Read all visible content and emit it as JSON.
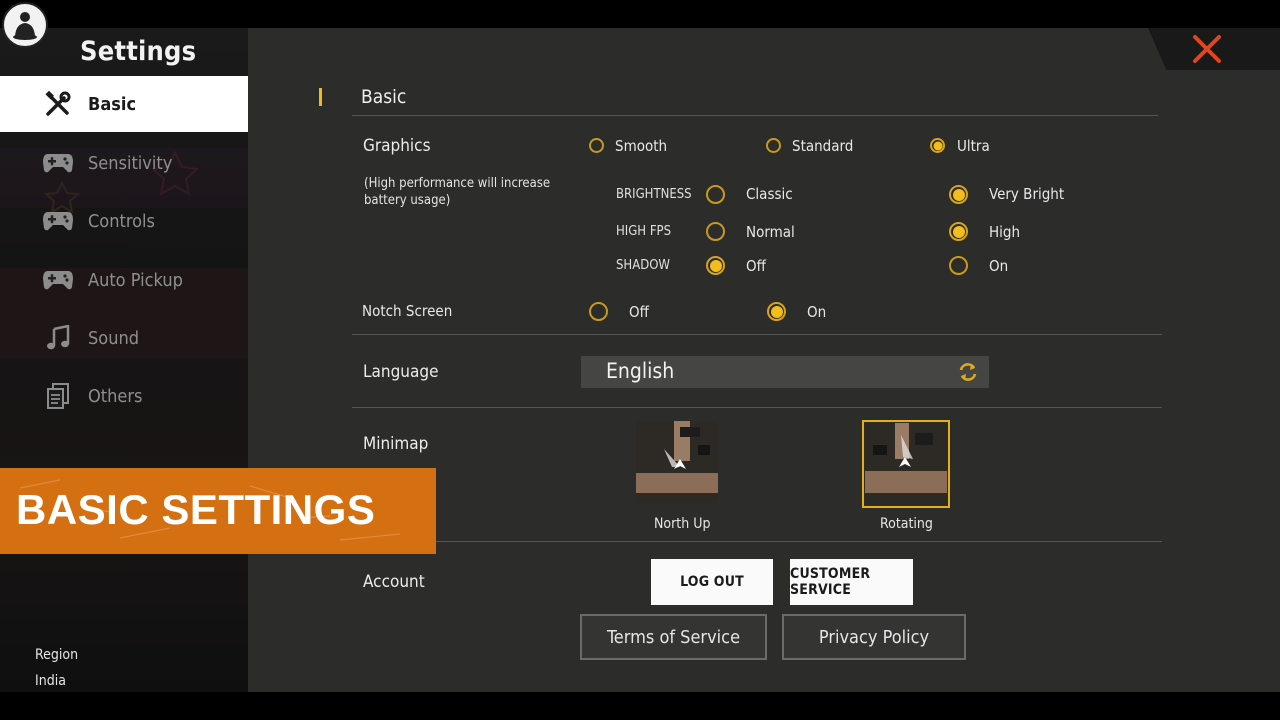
{
  "sidebar": {
    "title": "Settings",
    "items": [
      {
        "label": "Basic",
        "icon": "wrench-screwdriver-icon",
        "active": true
      },
      {
        "label": "Sensitivity",
        "icon": "gamepad-icon",
        "active": false
      },
      {
        "label": "Controls",
        "icon": "gamepad-icon",
        "active": false
      },
      {
        "label": "Auto Pickup",
        "icon": "gamepad-icon",
        "active": false
      },
      {
        "label": "Sound",
        "icon": "music-note-icon",
        "active": false
      },
      {
        "label": "Others",
        "icon": "document-icon",
        "active": false
      }
    ],
    "region_label": "Region",
    "region_value": "India"
  },
  "main": {
    "section_title": "Basic",
    "graphics": {
      "label": "Graphics",
      "note": "(High performance will increase battery usage)",
      "options": [
        {
          "label": "Smooth",
          "selected": false
        },
        {
          "label": "Standard",
          "selected": false
        },
        {
          "label": "Ultra",
          "selected": true
        }
      ],
      "brightness": {
        "label": "BRIGHTNESS",
        "opt1": "Classic",
        "opt2": "Very Bright",
        "selected": "Very Bright"
      },
      "high_fps": {
        "label": "HIGH FPS",
        "opt1": "Normal",
        "opt2": "High",
        "selected": "High"
      },
      "shadow": {
        "label": "SHADOW",
        "opt1": "Off",
        "opt2": "On",
        "selected": "Off"
      }
    },
    "notch_screen": {
      "label": "Notch Screen",
      "opt1": "Off",
      "opt2": "On",
      "selected": "On"
    },
    "language": {
      "label": "Language",
      "value": "English"
    },
    "minimap": {
      "label": "Minimap",
      "opt1": "North Up",
      "opt2": "Rotating",
      "selected": "Rotating"
    },
    "account": {
      "label": "Account",
      "logout": "LOG OUT",
      "customer_service": "CUSTOMER SERVICE",
      "terms": "Terms of Service",
      "privacy": "Privacy Policy"
    }
  },
  "overlay": {
    "caption": "BASIC SETTINGS"
  },
  "colors": {
    "accent": "#f3be1c",
    "panel": "#2c2c2b",
    "close": "#e2451d",
    "banner": "#d46f12"
  }
}
